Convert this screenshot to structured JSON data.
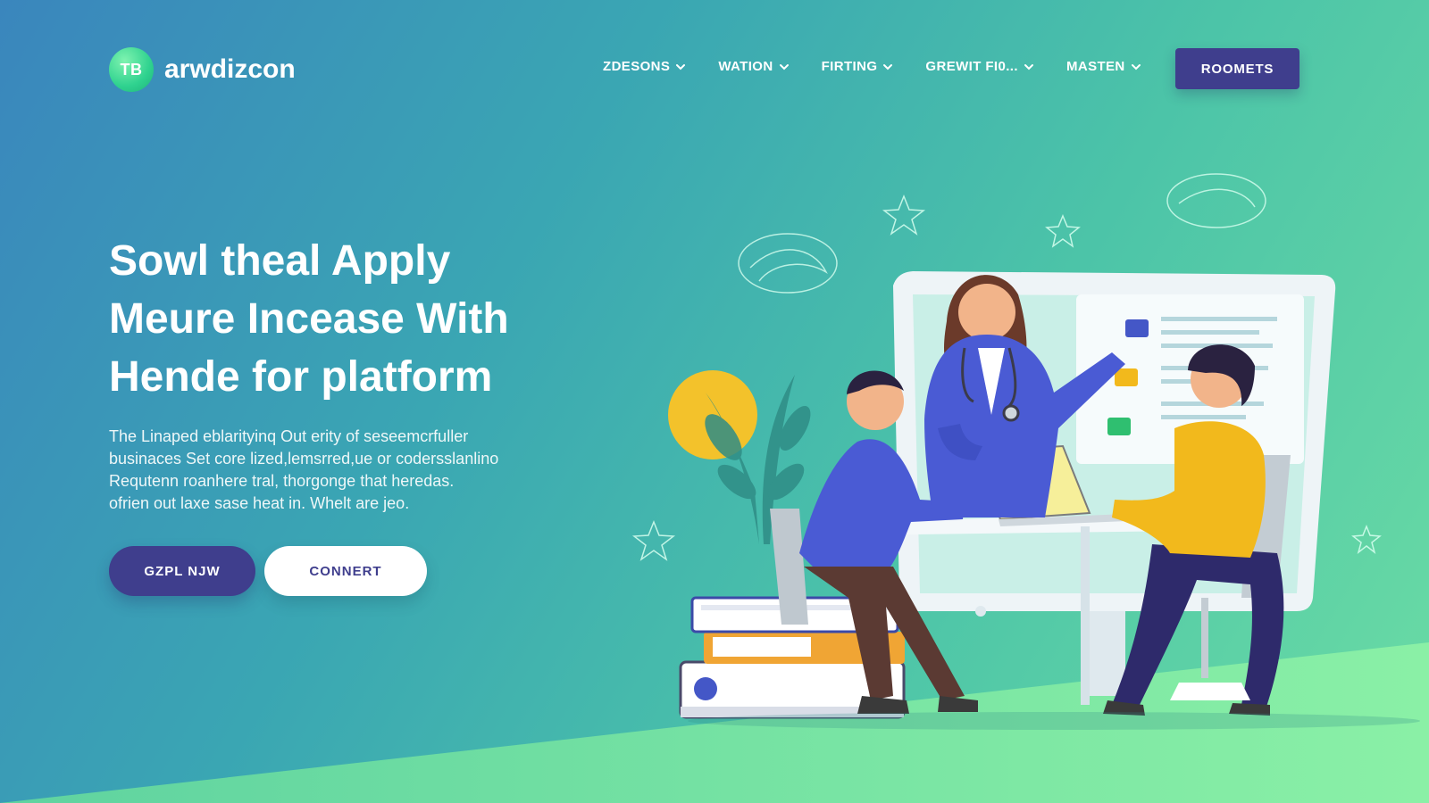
{
  "brand": {
    "logo_mark": "TB",
    "name": "arwdizcon"
  },
  "nav": {
    "items": [
      {
        "label": "ZDESONS"
      },
      {
        "label": "WATION"
      },
      {
        "label": "FIRTING"
      },
      {
        "label": "GREWIT FI0..."
      },
      {
        "label": "MASTEN"
      }
    ],
    "cta_label": "ROOMETS"
  },
  "hero": {
    "title_lines": [
      "Sowl theal Apply",
      "Meure Incease With",
      "Hende for platform"
    ],
    "body_lines": [
      "The Linaped eblarityinq Out erity of seseemcrfuller",
      "businaces Set core lized,lemsrred,ue or codersslanlino",
      "Requtenn roanhere tral, thorgonge that heredas.",
      "ofrien out laxe sase heat in. Whelt are jeo."
    ],
    "primary_button": "GZPL NJW",
    "secondary_button": "CONNERT"
  },
  "colors": {
    "accent": "#3f3e8d",
    "brand_green": "#2fd28f",
    "yellow": "#f3c22b",
    "shirt_blue": "#4a5bd4",
    "shirt_yellow": "#f2b91c"
  },
  "illustration": {
    "icons": [
      "sketch-star-icon",
      "sketch-scribble-icon",
      "plant-icon",
      "stethoscope-icon"
    ]
  }
}
